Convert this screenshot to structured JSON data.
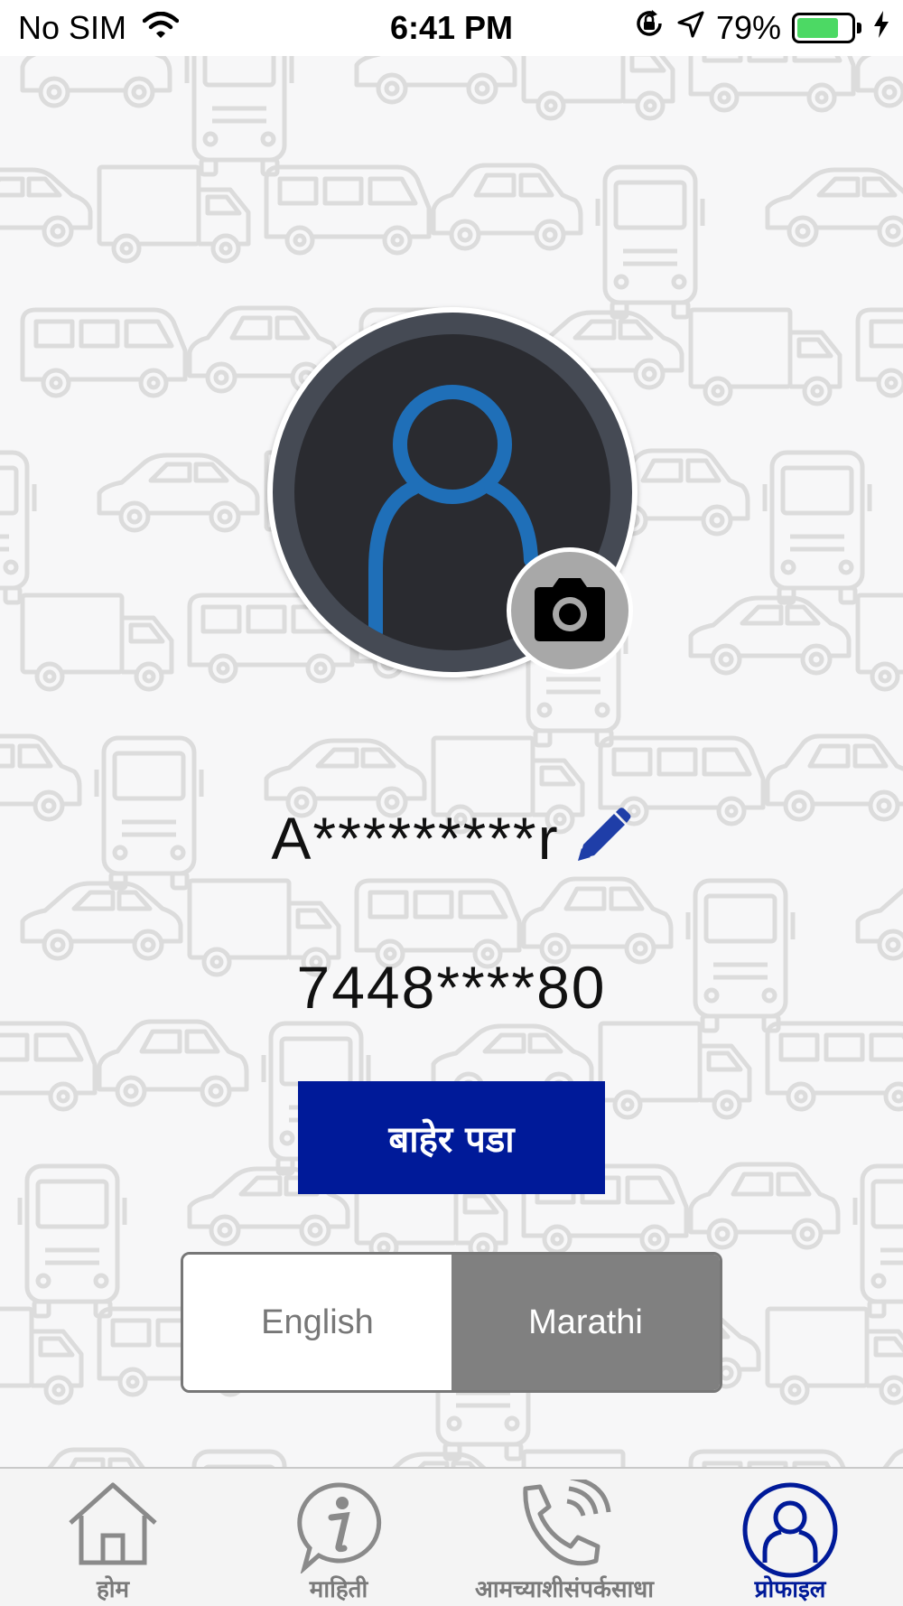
{
  "status_bar": {
    "carrier": "No SIM",
    "time": "6:41 PM",
    "battery_percent": "79%",
    "battery_level": 0.79,
    "battery_color": "#4cd964"
  },
  "profile": {
    "name": "A*********r",
    "phone": "7448****80",
    "avatar_icon": "user-icon",
    "camera_icon": "camera-icon",
    "edit_icon": "pencil-icon",
    "accent": "#1f6fb8"
  },
  "logout": {
    "label": "बाहेर पडा",
    "color": "#001a99"
  },
  "language": {
    "options": [
      {
        "label": "English",
        "selected": false
      },
      {
        "label": "Marathi",
        "selected": true
      }
    ]
  },
  "tabs": [
    {
      "label": "होम",
      "icon": "home-icon",
      "active": false
    },
    {
      "label": "माहिती",
      "icon": "info-icon",
      "active": false
    },
    {
      "label": "आमच्याशीसंपर्कसाधा",
      "icon": "phone-call-icon",
      "active": false
    },
    {
      "label": "प्रोफाइल",
      "icon": "profile-icon",
      "active": true
    }
  ]
}
